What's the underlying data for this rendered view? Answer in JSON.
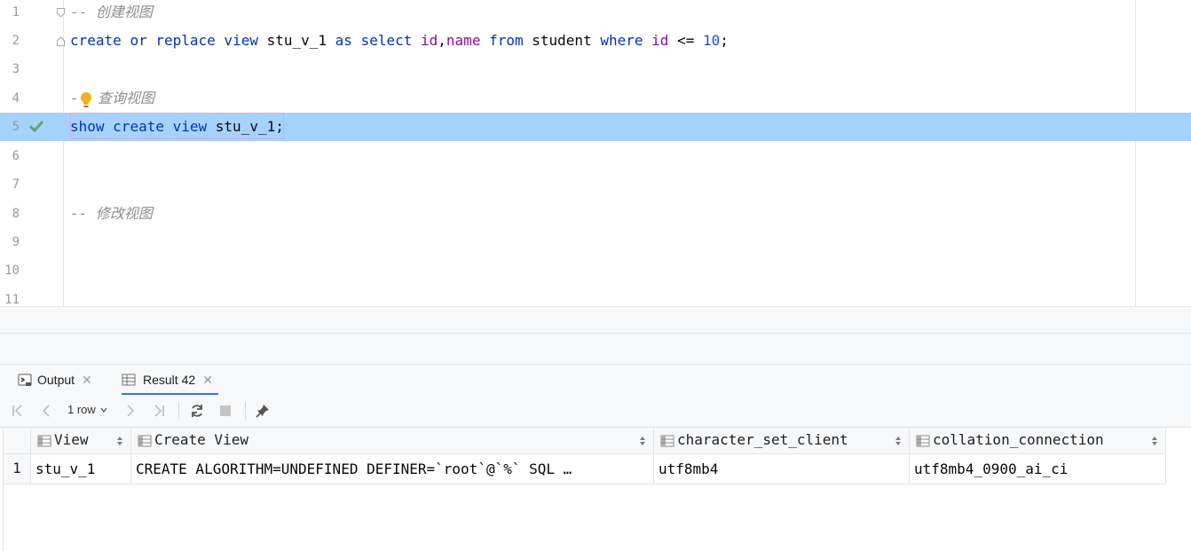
{
  "editor": {
    "lines": [
      {
        "num": "1"
      },
      {
        "num": "2"
      },
      {
        "num": "3"
      },
      {
        "num": "4"
      },
      {
        "num": "5"
      },
      {
        "num": "6"
      },
      {
        "num": "7"
      },
      {
        "num": "8"
      },
      {
        "num": "9"
      },
      {
        "num": "10"
      },
      {
        "num": "11"
      }
    ],
    "line1": {
      "comment": "-- 创建视图"
    },
    "line2": {
      "create": "create",
      "or": "or",
      "replace": "replace",
      "view": "view",
      "view_name": "stu_v_1",
      "as": "as",
      "select": "select",
      "col_id": "id",
      "comma": ",",
      "col_name": "name",
      "from": "from",
      "table": "student",
      "where": "where",
      "cond_col": "id",
      "op": "<=",
      "value": "10",
      "semi": ";"
    },
    "line4": {
      "dash": "-",
      "comment": "查询视图"
    },
    "line5": {
      "show": "show",
      "create": "create",
      "view": "view",
      "view_name": "stu_v_1",
      "semi": ";"
    },
    "line8": {
      "comment": "-- 修改视图"
    }
  },
  "tabs": [
    {
      "label": "Output",
      "icon": "console-icon"
    },
    {
      "label": "Result 42",
      "icon": "table-icon"
    }
  ],
  "toolbar": {
    "rows_label": "1 row",
    "icons": [
      "first-page-icon",
      "prev-page-icon",
      "next-page-icon",
      "last-page-icon",
      "refresh-icon",
      "stop-icon",
      "pin-icon"
    ]
  },
  "grid": {
    "columns": [
      "View",
      "Create View",
      "character_set_client",
      "collation_connection"
    ],
    "rows": [
      {
        "num": "1",
        "cells": [
          "stu_v_1",
          "CREATE ALGORITHM=UNDEFINED DEFINER=`root`@`%` SQL …",
          "utf8mb4",
          "utf8mb4_0900_ai_ci"
        ]
      }
    ]
  },
  "colors": {
    "keyword": "#0033b3",
    "identifier_purple": "#871094",
    "number": "#1750eb",
    "comment": "#8c8c8c",
    "selection": "#a6d2ff",
    "check": "#59a869",
    "bulb": "#f2b01e",
    "active_tab_underline": "#3574f0"
  }
}
